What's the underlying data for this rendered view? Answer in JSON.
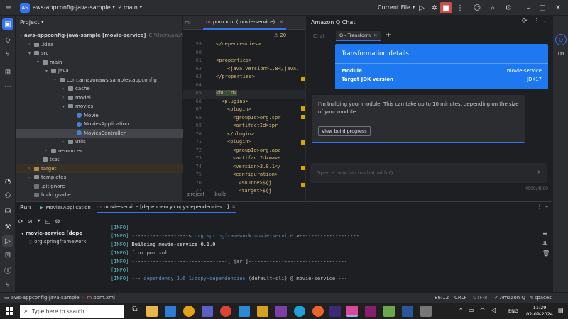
{
  "titlebar": {
    "project_badge": "AS",
    "project_name": "aws-appconfig-java-sample",
    "branch": "main",
    "current_file": "Current File"
  },
  "project_panel": {
    "title": "Project",
    "tree": [
      {
        "label": "aws-appconfig-java-sample [movie-service]",
        "extra": "C:\\Users\\aws\\IdeaProjects",
        "depth": 0,
        "kind": "folder",
        "open": true
      },
      {
        "label": ".idea",
        "depth": 1,
        "kind": "folder",
        "open": false
      },
      {
        "label": "src",
        "depth": 1,
        "kind": "folder",
        "open": true
      },
      {
        "label": "main",
        "depth": 2,
        "kind": "folder",
        "open": true
      },
      {
        "label": "java",
        "depth": 3,
        "kind": "folder",
        "open": true
      },
      {
        "label": "com.amazonaws.samples.appconfig",
        "depth": 4,
        "kind": "folder",
        "open": true
      },
      {
        "label": "cache",
        "depth": 5,
        "kind": "folder",
        "open": false
      },
      {
        "label": "model",
        "depth": 5,
        "kind": "folder",
        "open": false
      },
      {
        "label": "movies",
        "depth": 5,
        "kind": "folder",
        "open": true
      },
      {
        "label": "Movie",
        "depth": 6,
        "kind": "class"
      },
      {
        "label": "MoviesApplication",
        "depth": 6,
        "kind": "class"
      },
      {
        "label": "MoviesController",
        "depth": 6,
        "kind": "class",
        "selected": true
      },
      {
        "label": "utils",
        "depth": 5,
        "kind": "folder",
        "open": false
      },
      {
        "label": "resources",
        "depth": 3,
        "kind": "folder",
        "open": false
      },
      {
        "label": "test",
        "depth": 2,
        "kind": "folder",
        "open": false
      },
      {
        "label": "target",
        "depth": 1,
        "kind": "folder",
        "open": false,
        "highlight": true
      },
      {
        "label": "templates",
        "depth": 1,
        "kind": "folder",
        "open": false
      },
      {
        "label": ".gitignore",
        "depth": 1,
        "kind": "file"
      },
      {
        "label": "build.gradle",
        "depth": 1,
        "kind": "file"
      }
    ]
  },
  "editor": {
    "tab_prev": "ml",
    "tab_label": "pom.xml (movie-service)",
    "warnings": "20",
    "bottom_tabs": [
      "project",
      "build"
    ],
    "lines": [
      {
        "n": "59",
        "text": "</dependencies>",
        "ind": 2
      },
      {
        "n": "60",
        "text": "",
        "ind": 0
      },
      {
        "n": "61",
        "text": "<properties>",
        "ind": 2
      },
      {
        "n": "62",
        "text": "<java.version>1.8</java.",
        "ind": 4
      },
      {
        "n": "63",
        "text": "</properties>",
        "ind": 2
      },
      {
        "n": "64",
        "text": "",
        "ind": 0
      },
      {
        "n": "65",
        "text": "<build>",
        "ind": 2,
        "highlight": true
      },
      {
        "n": "66",
        "text": "<plugins>",
        "ind": 3
      },
      {
        "n": "67",
        "text": "<plugin>",
        "ind": 4
      },
      {
        "n": "68",
        "text": "<groupId>org.spr",
        "ind": 5
      },
      {
        "n": "69",
        "text": "<artifactId>spr",
        "ind": 5
      },
      {
        "n": "70",
        "text": "</plugin>",
        "ind": 4
      },
      {
        "n": "71",
        "text": "<plugin>",
        "ind": 4
      },
      {
        "n": "72",
        "text": "<groupId>org.apa",
        "ind": 5
      },
      {
        "n": "73",
        "text": "<artifactId>mave",
        "ind": 5
      },
      {
        "n": "74",
        "text": "<version>3.8.1</",
        "ind": 5
      },
      {
        "n": "75",
        "text": "<configuration>",
        "ind": 5
      },
      {
        "n": "76",
        "text": "<source>${j",
        "ind": 6
      },
      {
        "n": "77",
        "text": "<target>${j",
        "ind": 6
      }
    ]
  },
  "qchat": {
    "title": "Amazon Q Chat",
    "tab_chat": "Chat",
    "tab_transform": "Q - Transform",
    "details_title": "Transformation details",
    "rows": [
      {
        "label": "Module",
        "value": "movie-service"
      },
      {
        "label": "Target JDK version",
        "value": "JDK17"
      }
    ],
    "message": "I'm building your module. This can take up to 10 minutes, depending on the size of your module.",
    "progress_button": "View build progress",
    "input_placeholder": "Open a new tab to chat with Q",
    "char_count": "4000/4000"
  },
  "run_panel": {
    "title": "Run",
    "tab1": "MoviesApplication",
    "tab2": "movie-service [dependency:copy-dependencies...]",
    "tree": [
      {
        "label": "movie-service [depe",
        "bold": true
      },
      {
        "label": "org.springframework",
        "bold": false
      }
    ],
    "console": [
      {
        "tag": "[INFO]",
        "text": "",
        "dim": ""
      },
      {
        "tag": "[INFO]",
        "text": "-------------------< ",
        "dim": "org.springframework:movie-service",
        "tail": " >--------------------"
      },
      {
        "tag": "[INFO]",
        "text": "Building movie-service 0.1.0",
        "dim": ""
      },
      {
        "tag": "[INFO]",
        "text": "  from pom.xml",
        "dim": ""
      },
      {
        "tag": "[INFO]",
        "text": "--------------------------------[ jar ]---------------------------------",
        "dim": ""
      },
      {
        "tag": "[INFO]",
        "text": "",
        "dim": ""
      },
      {
        "tag": "[INFO]",
        "text": "--- ",
        "dim": "dependency:3.6.1:copy-dependencies",
        "tail": " (default-cli) @ movie-service ---"
      }
    ]
  },
  "status_bar": {
    "path": [
      "aws-appconfig-java-sample",
      "pom.xml"
    ],
    "position": "86:12",
    "line_ending": "CRLF",
    "encoding": "UTF-8",
    "amazon_q": "Amazon Q",
    "indent": "4 spaces"
  },
  "taskbar": {
    "search_placeholder": "Type here to search",
    "time": "11:29",
    "date": "02-09-2024",
    "lang": "ENG"
  },
  "colors": {
    "accent": "#3574f0",
    "q_blue": "#1e78ef",
    "close_red": "#c94f4f"
  }
}
